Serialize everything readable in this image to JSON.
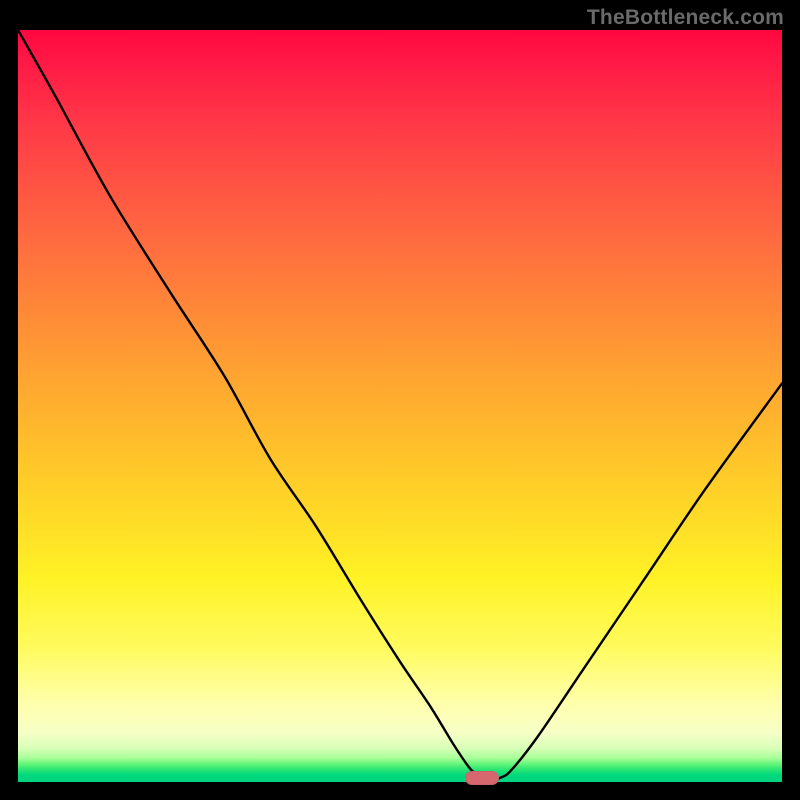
{
  "watermark": "TheBottleneck.com",
  "marker": {
    "x_pct": 60.7,
    "color": "#d7676f"
  },
  "chart_data": {
    "type": "line",
    "title": "",
    "xlabel": "",
    "ylabel": "",
    "xlim": [
      0,
      100
    ],
    "ylim": [
      0,
      100
    ],
    "grid": false,
    "legend": false,
    "series": [
      {
        "name": "bottleneck-curve",
        "x": [
          0,
          5,
          12,
          20,
          27,
          33,
          39,
          45,
          50,
          54,
          57,
          59,
          60,
          61,
          62,
          63,
          64.5,
          68,
          74,
          82,
          90,
          100
        ],
        "y": [
          100,
          91,
          78,
          65,
          54,
          43,
          34,
          24,
          16,
          10,
          5,
          2,
          1,
          0,
          0,
          0.5,
          1.5,
          6,
          15,
          27,
          39,
          53
        ]
      }
    ],
    "annotations": [
      {
        "type": "marker",
        "x": 60.7,
        "y": 0,
        "color": "#d7676f",
        "shape": "pill"
      }
    ],
    "background": {
      "type": "vertical-gradient",
      "stops": [
        {
          "pct": 0,
          "color": "#ff073f"
        },
        {
          "pct": 27,
          "color": "#ff6840"
        },
        {
          "pct": 60,
          "color": "#ffcd28"
        },
        {
          "pct": 82,
          "color": "#fffb5d"
        },
        {
          "pct": 95,
          "color": "#d8ffb8"
        },
        {
          "pct": 100,
          "color": "#00d37e"
        }
      ]
    }
  }
}
